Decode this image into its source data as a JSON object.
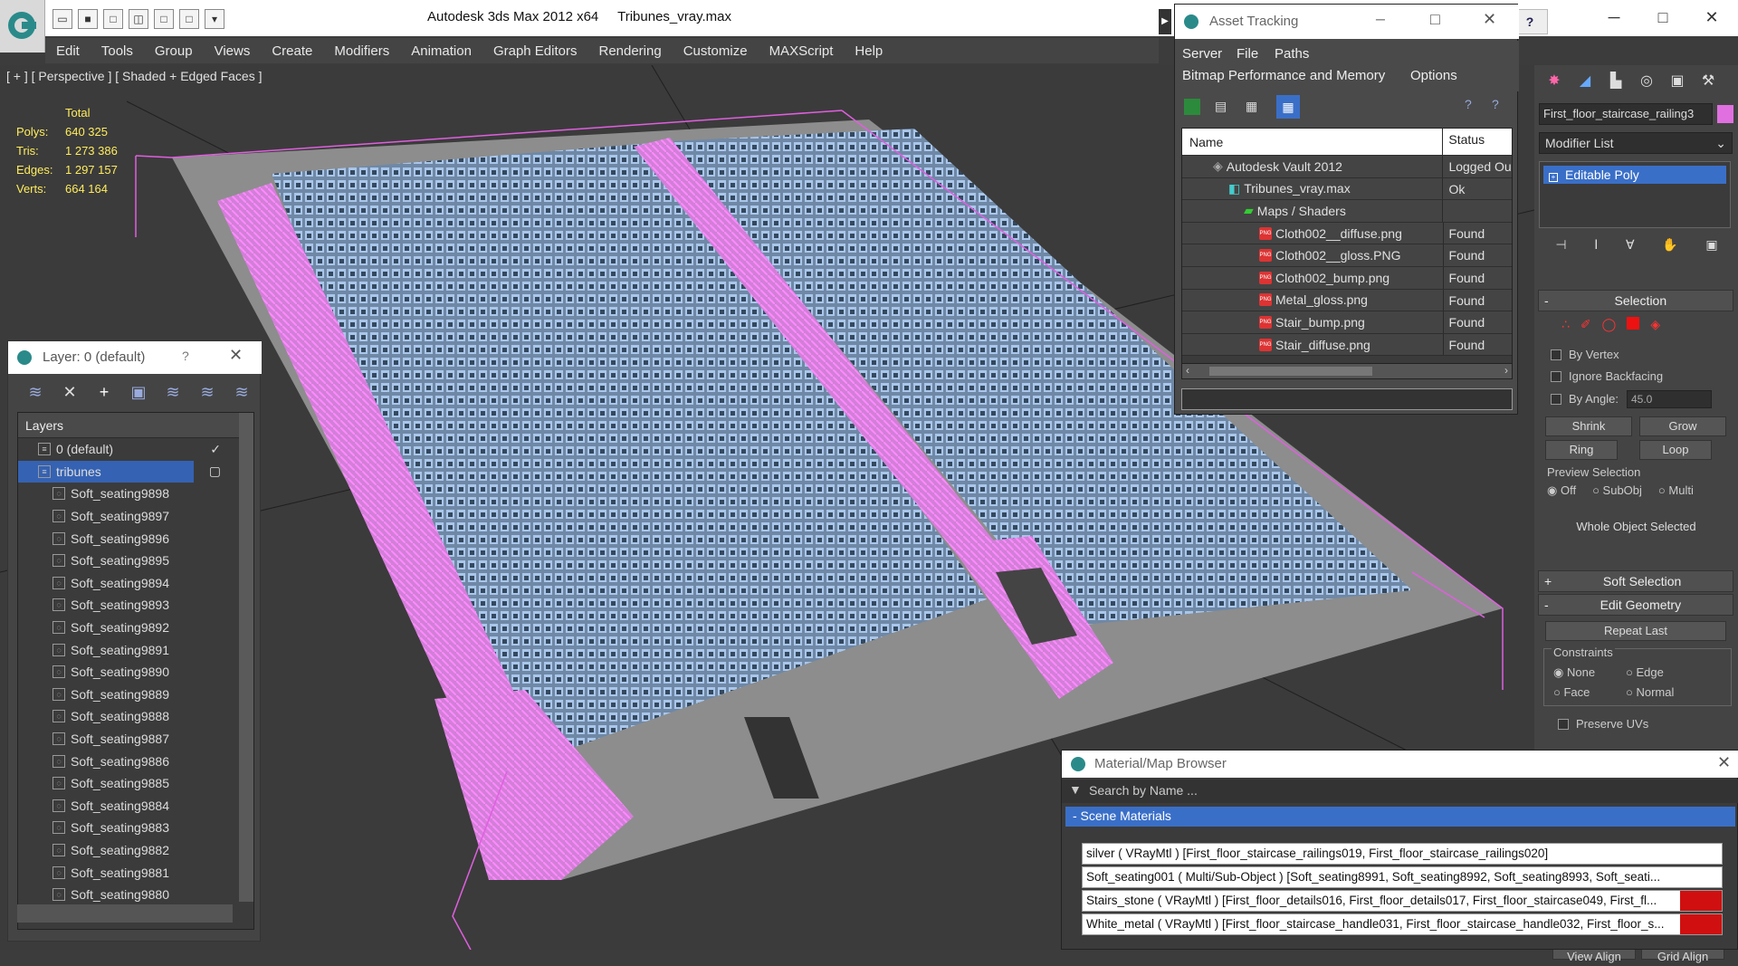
{
  "window": {
    "title": "Autodesk 3ds Max  2012 x64",
    "filename": "Tribunes_vray.max"
  },
  "menu": [
    "Edit",
    "Tools",
    "Group",
    "Views",
    "Create",
    "Modifiers",
    "Animation",
    "Graph Editors",
    "Rendering",
    "Customize",
    "MAXScript",
    "Help"
  ],
  "viewport": {
    "label": "[ + ] [ Perspective ] [ Shaded + Edged Faces ]",
    "stats": {
      "header": "Total",
      "rows": [
        {
          "k": "Polys:",
          "v": "640 325"
        },
        {
          "k": "Tris:",
          "v": "1 273 386"
        },
        {
          "k": "Edges:",
          "v": "1 297 157"
        },
        {
          "k": "Verts:",
          "v": "664 164"
        }
      ]
    }
  },
  "layer_panel": {
    "title": "Layer: 0 (default)",
    "help": "?",
    "list_header": "Layers",
    "rows": [
      {
        "label": "0 (default)",
        "level": 1,
        "selected": false
      },
      {
        "label": "tribunes",
        "level": 1,
        "selected": true
      },
      {
        "label": "Soft_seating9898",
        "level": 2
      },
      {
        "label": "Soft_seating9897",
        "level": 2
      },
      {
        "label": "Soft_seating9896",
        "level": 2
      },
      {
        "label": "Soft_seating9895",
        "level": 2
      },
      {
        "label": "Soft_seating9894",
        "level": 2
      },
      {
        "label": "Soft_seating9893",
        "level": 2
      },
      {
        "label": "Soft_seating9892",
        "level": 2
      },
      {
        "label": "Soft_seating9891",
        "level": 2
      },
      {
        "label": "Soft_seating9890",
        "level": 2
      },
      {
        "label": "Soft_seating9889",
        "level": 2
      },
      {
        "label": "Soft_seating9888",
        "level": 2
      },
      {
        "label": "Soft_seating9887",
        "level": 2
      },
      {
        "label": "Soft_seating9886",
        "level": 2
      },
      {
        "label": "Soft_seating9885",
        "level": 2
      },
      {
        "label": "Soft_seating9884",
        "level": 2
      },
      {
        "label": "Soft_seating9883",
        "level": 2
      },
      {
        "label": "Soft_seating9882",
        "level": 2
      },
      {
        "label": "Soft_seating9881",
        "level": 2
      },
      {
        "label": "Soft_seating9880",
        "level": 2
      }
    ]
  },
  "asset_tracking": {
    "title": "Asset Tracking",
    "menu1": [
      "Server",
      "File",
      "Paths"
    ],
    "menu2": [
      "Bitmap Performance and Memory",
      "Options"
    ],
    "columns": {
      "name": "Name",
      "status": "Status"
    },
    "rows": [
      {
        "name": "Autodesk Vault 2012",
        "status": "Logged Ou",
        "indent": 2,
        "icon": "vault"
      },
      {
        "name": "Tribunes_vray.max",
        "status": "Ok",
        "indent": 3,
        "icon": "max"
      },
      {
        "name": "Maps / Shaders",
        "status": "",
        "indent": 4,
        "icon": "folder"
      },
      {
        "name": "Cloth002__diffuse.png",
        "status": "Found",
        "indent": 5,
        "icon": "png"
      },
      {
        "name": "Cloth002__gloss.PNG",
        "status": "Found",
        "indent": 5,
        "icon": "png"
      },
      {
        "name": "Cloth002_bump.png",
        "status": "Found",
        "indent": 5,
        "icon": "png"
      },
      {
        "name": "Metal_gloss.png",
        "status": "Found",
        "indent": 5,
        "icon": "png"
      },
      {
        "name": "Stair_bump.png",
        "status": "Found",
        "indent": 5,
        "icon": "png"
      },
      {
        "name": "Stair_diffuse.png",
        "status": "Found",
        "indent": 5,
        "icon": "png"
      }
    ]
  },
  "command_panel": {
    "object_name": "First_floor_staircase_railing3",
    "modifier_list": "Modifier List",
    "stack_item": "Editable Poly",
    "selection": {
      "title": "Selection",
      "by_vertex": "By Vertex",
      "ignore_backfacing": "Ignore Backfacing",
      "by_angle": "By Angle:",
      "angle_value": "45.0",
      "shrink": "Shrink",
      "grow": "Grow",
      "ring": "Ring",
      "loop": "Loop",
      "preview": "Preview Selection",
      "preview_opts": [
        "Off",
        "SubObj",
        "Multi"
      ],
      "status": "Whole Object Selected"
    },
    "soft_selection": "Soft Selection",
    "edit_geometry": "Edit Geometry",
    "repeat_last": "Repeat Last",
    "constraints": "Constraints",
    "constraint_opts": [
      "None",
      "Edge",
      "Face",
      "Normal"
    ],
    "preserve_uvs": "Preserve UVs",
    "bottom_buttons": [
      "View Align",
      "Grid Align"
    ]
  },
  "material_browser": {
    "title": "Material/Map Browser",
    "search_placeholder": "Search by Name ...",
    "group": "- Scene Materials",
    "rows": [
      "silver ( VRayMtl ) [First_floor_staircase_railings019, First_floor_staircase_railings020]",
      "Soft_seating001 ( Multi/Sub-Object ) [Soft_seating8991, Soft_seating8992, Soft_seating8993, Soft_seati...",
      "Stairs_stone ( VRayMtl ) [First_floor_details016, First_floor_details017, First_floor_staircase049, First_fl...",
      "White_metal ( VRayMtl ) [First_floor_staircase_handle031, First_floor_staircase_handle032, First_floor_s..."
    ]
  }
}
